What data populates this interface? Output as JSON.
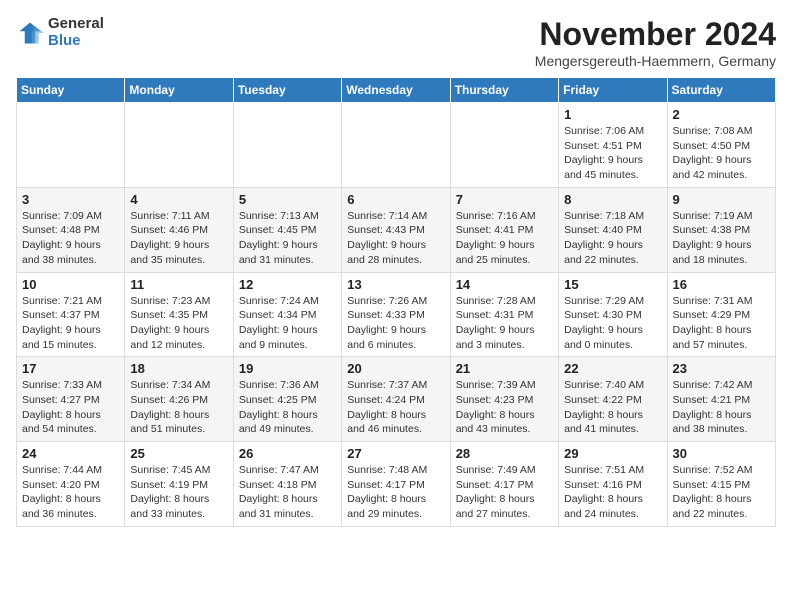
{
  "logo": {
    "general": "General",
    "blue": "Blue"
  },
  "title": "November 2024",
  "subtitle": "Mengersgereuth-Haemmern, Germany",
  "days_header": [
    "Sunday",
    "Monday",
    "Tuesday",
    "Wednesday",
    "Thursday",
    "Friday",
    "Saturday"
  ],
  "weeks": [
    [
      {
        "day": "",
        "info": ""
      },
      {
        "day": "",
        "info": ""
      },
      {
        "day": "",
        "info": ""
      },
      {
        "day": "",
        "info": ""
      },
      {
        "day": "",
        "info": ""
      },
      {
        "day": "1",
        "info": "Sunrise: 7:06 AM\nSunset: 4:51 PM\nDaylight: 9 hours\nand 45 minutes."
      },
      {
        "day": "2",
        "info": "Sunrise: 7:08 AM\nSunset: 4:50 PM\nDaylight: 9 hours\nand 42 minutes."
      }
    ],
    [
      {
        "day": "3",
        "info": "Sunrise: 7:09 AM\nSunset: 4:48 PM\nDaylight: 9 hours\nand 38 minutes."
      },
      {
        "day": "4",
        "info": "Sunrise: 7:11 AM\nSunset: 4:46 PM\nDaylight: 9 hours\nand 35 minutes."
      },
      {
        "day": "5",
        "info": "Sunrise: 7:13 AM\nSunset: 4:45 PM\nDaylight: 9 hours\nand 31 minutes."
      },
      {
        "day": "6",
        "info": "Sunrise: 7:14 AM\nSunset: 4:43 PM\nDaylight: 9 hours\nand 28 minutes."
      },
      {
        "day": "7",
        "info": "Sunrise: 7:16 AM\nSunset: 4:41 PM\nDaylight: 9 hours\nand 25 minutes."
      },
      {
        "day": "8",
        "info": "Sunrise: 7:18 AM\nSunset: 4:40 PM\nDaylight: 9 hours\nand 22 minutes."
      },
      {
        "day": "9",
        "info": "Sunrise: 7:19 AM\nSunset: 4:38 PM\nDaylight: 9 hours\nand 18 minutes."
      }
    ],
    [
      {
        "day": "10",
        "info": "Sunrise: 7:21 AM\nSunset: 4:37 PM\nDaylight: 9 hours\nand 15 minutes."
      },
      {
        "day": "11",
        "info": "Sunrise: 7:23 AM\nSunset: 4:35 PM\nDaylight: 9 hours\nand 12 minutes."
      },
      {
        "day": "12",
        "info": "Sunrise: 7:24 AM\nSunset: 4:34 PM\nDaylight: 9 hours\nand 9 minutes."
      },
      {
        "day": "13",
        "info": "Sunrise: 7:26 AM\nSunset: 4:33 PM\nDaylight: 9 hours\nand 6 minutes."
      },
      {
        "day": "14",
        "info": "Sunrise: 7:28 AM\nSunset: 4:31 PM\nDaylight: 9 hours\nand 3 minutes."
      },
      {
        "day": "15",
        "info": "Sunrise: 7:29 AM\nSunset: 4:30 PM\nDaylight: 9 hours\nand 0 minutes."
      },
      {
        "day": "16",
        "info": "Sunrise: 7:31 AM\nSunset: 4:29 PM\nDaylight: 8 hours\nand 57 minutes."
      }
    ],
    [
      {
        "day": "17",
        "info": "Sunrise: 7:33 AM\nSunset: 4:27 PM\nDaylight: 8 hours\nand 54 minutes."
      },
      {
        "day": "18",
        "info": "Sunrise: 7:34 AM\nSunset: 4:26 PM\nDaylight: 8 hours\nand 51 minutes."
      },
      {
        "day": "19",
        "info": "Sunrise: 7:36 AM\nSunset: 4:25 PM\nDaylight: 8 hours\nand 49 minutes."
      },
      {
        "day": "20",
        "info": "Sunrise: 7:37 AM\nSunset: 4:24 PM\nDaylight: 8 hours\nand 46 minutes."
      },
      {
        "day": "21",
        "info": "Sunrise: 7:39 AM\nSunset: 4:23 PM\nDaylight: 8 hours\nand 43 minutes."
      },
      {
        "day": "22",
        "info": "Sunrise: 7:40 AM\nSunset: 4:22 PM\nDaylight: 8 hours\nand 41 minutes."
      },
      {
        "day": "23",
        "info": "Sunrise: 7:42 AM\nSunset: 4:21 PM\nDaylight: 8 hours\nand 38 minutes."
      }
    ],
    [
      {
        "day": "24",
        "info": "Sunrise: 7:44 AM\nSunset: 4:20 PM\nDaylight: 8 hours\nand 36 minutes."
      },
      {
        "day": "25",
        "info": "Sunrise: 7:45 AM\nSunset: 4:19 PM\nDaylight: 8 hours\nand 33 minutes."
      },
      {
        "day": "26",
        "info": "Sunrise: 7:47 AM\nSunset: 4:18 PM\nDaylight: 8 hours\nand 31 minutes."
      },
      {
        "day": "27",
        "info": "Sunrise: 7:48 AM\nSunset: 4:17 PM\nDaylight: 8 hours\nand 29 minutes."
      },
      {
        "day": "28",
        "info": "Sunrise: 7:49 AM\nSunset: 4:17 PM\nDaylight: 8 hours\nand 27 minutes."
      },
      {
        "day": "29",
        "info": "Sunrise: 7:51 AM\nSunset: 4:16 PM\nDaylight: 8 hours\nand 24 minutes."
      },
      {
        "day": "30",
        "info": "Sunrise: 7:52 AM\nSunset: 4:15 PM\nDaylight: 8 hours\nand 22 minutes."
      }
    ]
  ]
}
